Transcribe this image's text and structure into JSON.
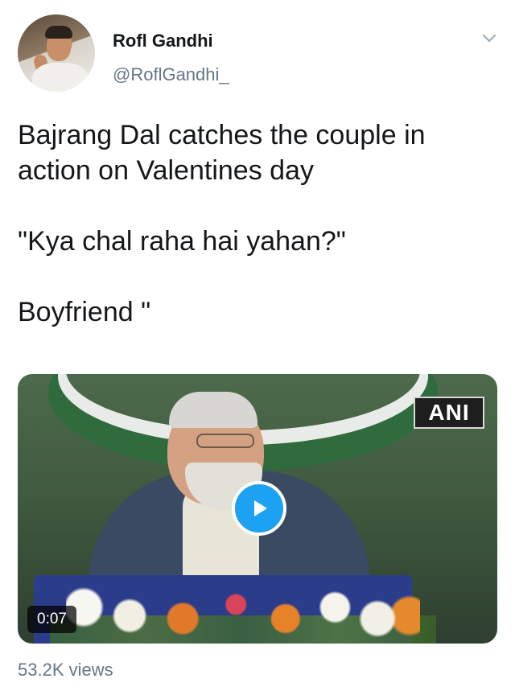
{
  "author": {
    "display_name": "Rofl Gandhi",
    "handle": "@RoflGandhi_"
  },
  "tweet": {
    "paragraphs": [
      "Bajrang Dal catches the couple in action on Valentines day",
      "\"Kya chal raha hai yahan?\"",
      "Boyfriend \""
    ]
  },
  "media": {
    "watermark": "ANI",
    "duration": "0:07",
    "play_icon": "play-icon"
  },
  "stats": {
    "views": "53.2K views"
  },
  "colors": {
    "accent": "#1da1f2",
    "secondary_text": "#657786",
    "primary_text": "#14171a"
  }
}
